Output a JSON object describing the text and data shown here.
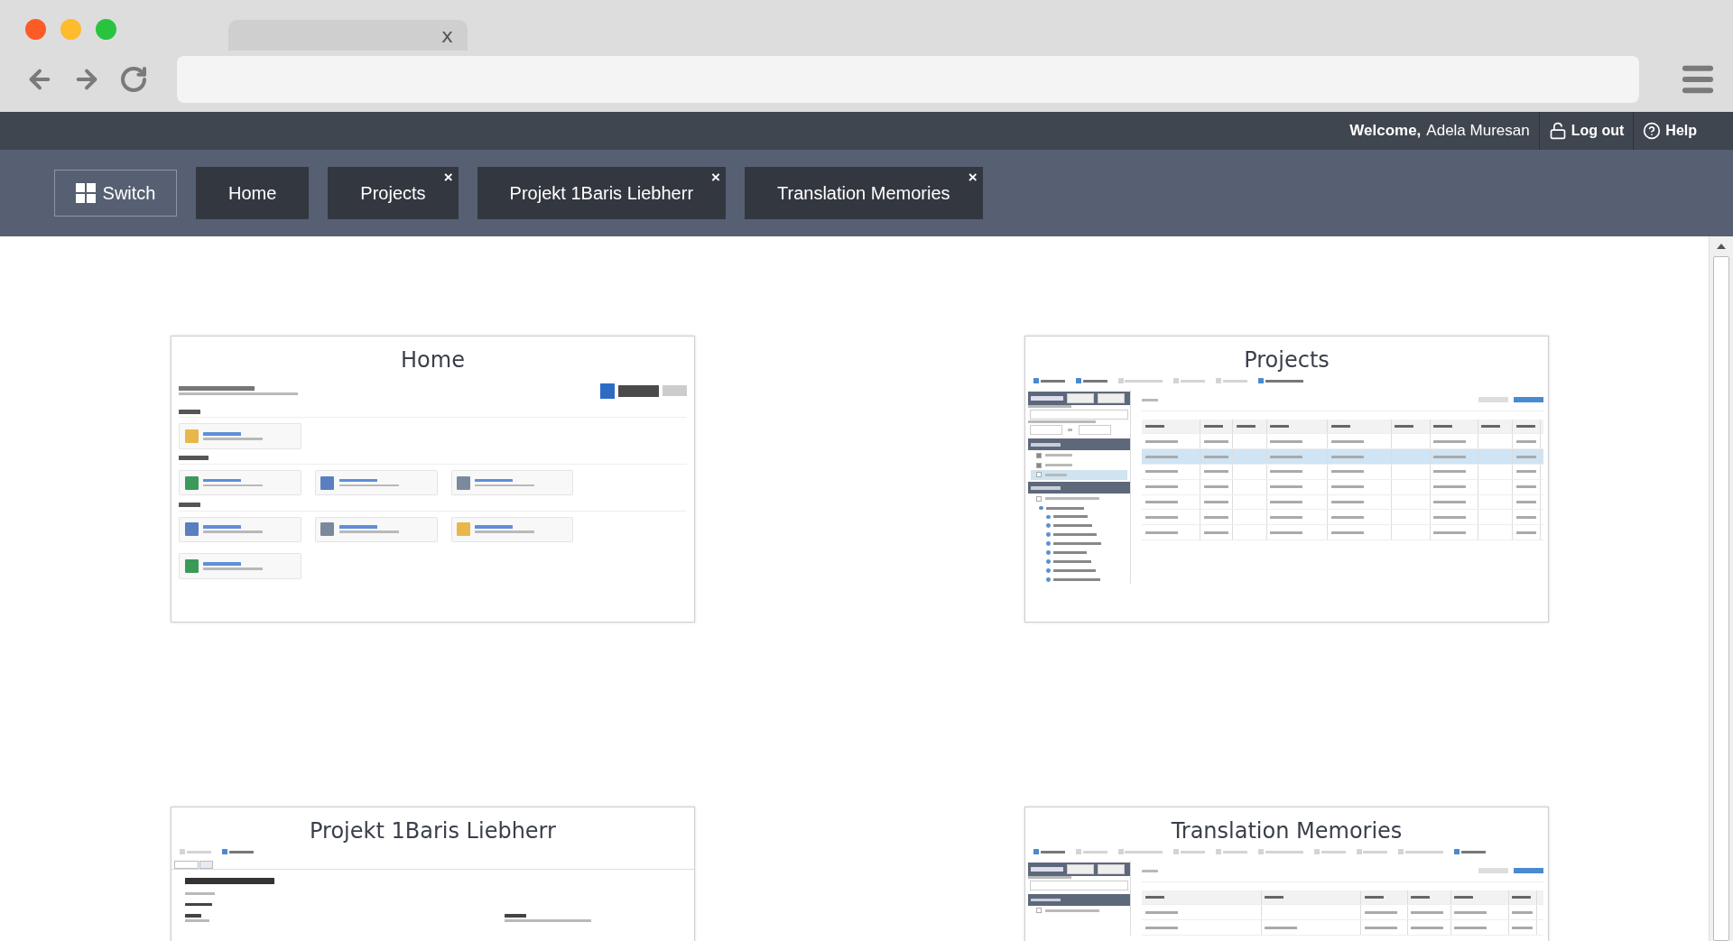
{
  "browser": {
    "tab_close": "x"
  },
  "header": {
    "welcome_label": "Welcome,",
    "user_name": "Adela Muresan",
    "logout": "Log out",
    "help": "Help"
  },
  "switch_button": "Switch",
  "tabs": [
    {
      "label": "Home",
      "selected": false
    },
    {
      "label": "Projects",
      "close": "×",
      "selected": false
    },
    {
      "label": "Projekt 1Baris Liebherr",
      "close": "×",
      "selected": false
    },
    {
      "label": "Translation Memories",
      "close": "×",
      "selected": false
    }
  ],
  "cards": [
    {
      "kind": "home",
      "title": "Home"
    },
    {
      "kind": "projects",
      "title": "Projects"
    },
    {
      "kind": "detail",
      "title": "Projekt 1Baris Liebherr"
    },
    {
      "kind": "memories",
      "title": "Translation Memories"
    }
  ]
}
